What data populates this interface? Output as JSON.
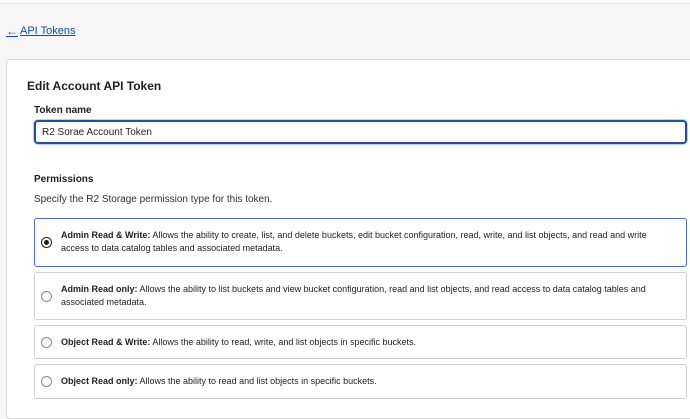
{
  "nav": {
    "back_arrow": "←",
    "back_label": "API Tokens"
  },
  "form": {
    "title": "Edit Account API Token",
    "token_name_label": "Token name",
    "token_name_value": "R2 Sorae Account Token",
    "permissions_heading": "Permissions",
    "permissions_description": "Specify the R2 Storage permission type for this token."
  },
  "permissions": [
    {
      "name": "Admin Read & Write:",
      "description": " Allows the ability to create, list, and delete buckets, edit bucket configuration, read, write, and list objects, and read and write access to data catalog tables and associated metadata.",
      "selected": true
    },
    {
      "name": "Admin Read only:",
      "description": " Allows the ability to list buckets and view bucket configuration, read and list objects, and read access to data catalog tables and associated metadata.",
      "selected": false
    },
    {
      "name": "Object Read & Write:",
      "description": " Allows the ability to read, write, and list objects in specific buckets.",
      "selected": false
    },
    {
      "name": "Object Read only:",
      "description": " Allows the ability to read and list objects in specific buckets.",
      "selected": false
    }
  ],
  "colors": {
    "link": "#0051c3",
    "input_focus_border": "#1a4fb5",
    "selected_option_border": "#4a72c9"
  }
}
